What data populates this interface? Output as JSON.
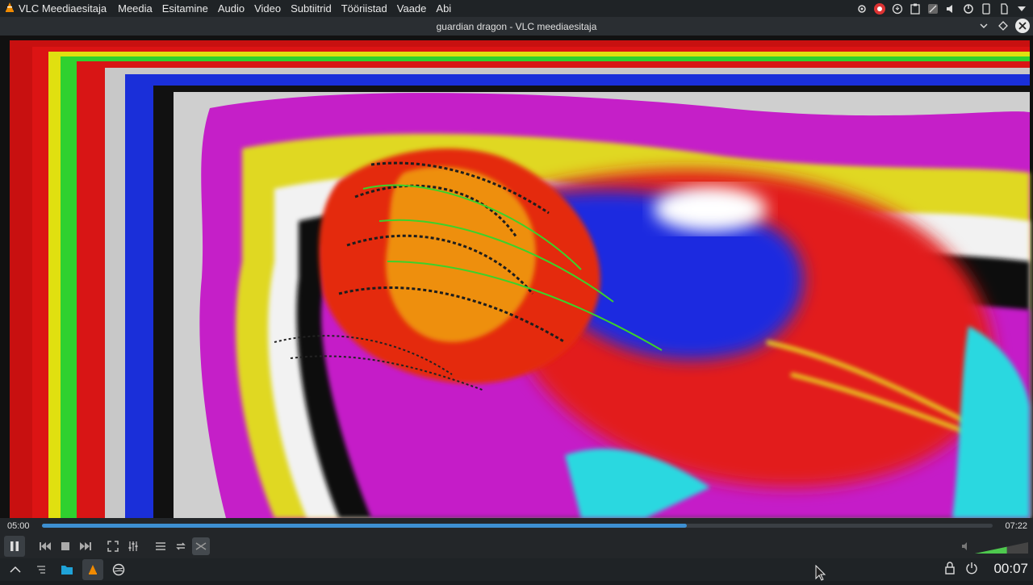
{
  "app": {
    "name": "VLC Meediaesitaja"
  },
  "menu": [
    "Meedia",
    "Esitamine",
    "Audio",
    "Video",
    "Subtiitrid",
    "Tööriistad",
    "Vaade",
    "Abi"
  ],
  "window": {
    "title": "guardian dragon - VLC meediaesitaja"
  },
  "playback": {
    "elapsed": "05:00",
    "total": "07:22",
    "progress": 0.678
  },
  "volume": {
    "level": 0.6,
    "label": "60%"
  },
  "clock": "00:07",
  "colors": {
    "accent": "#3d8fd1",
    "volume": "#4ec94e",
    "vlc_orange": "#f08a00"
  },
  "tray_icons": [
    "settings-icon",
    "browser-icon",
    "update-icon",
    "clipboard-icon",
    "network-icon",
    "audio-icon",
    "battery-icon",
    "bluetooth-icon",
    "notifications-icon",
    "expand-icon"
  ]
}
